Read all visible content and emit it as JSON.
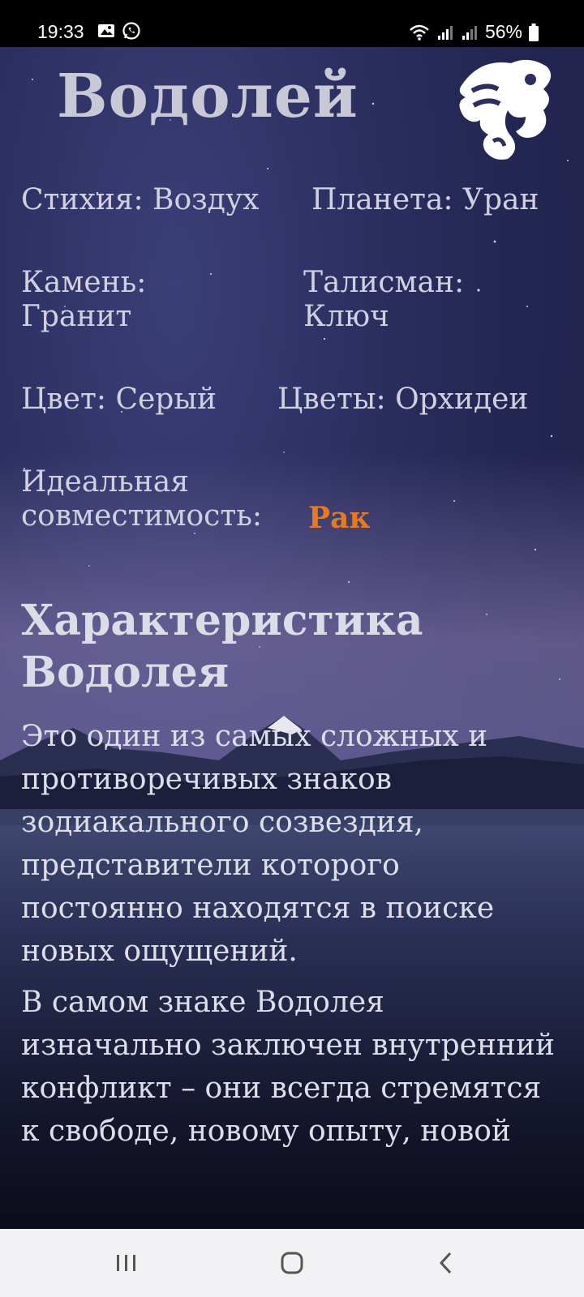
{
  "status_bar": {
    "time": "19:33",
    "battery": "56%",
    "icons": [
      "gallery-icon",
      "whatsapp-icon",
      "wifi-icon",
      "signal-icon",
      "signal-icon",
      "battery-icon"
    ]
  },
  "header": {
    "title": "Водолей",
    "emblem_icon": "aquarius-emblem-icon"
  },
  "info": {
    "element": "Стихия: Воздух",
    "planet": "Планета: Уран",
    "stone_line1": "Камень:",
    "stone_line2": "Гранит",
    "talisman_line1": "Талисман:",
    "talisman_line2": "Ключ",
    "color": "Цвет: Серый",
    "flowers": "Цветы: Орхидеи",
    "compat_line1": "Идеальная",
    "compat_line2": "совместимость:",
    "compat_value": "Рак"
  },
  "section": {
    "title_line1": "Характеристика",
    "title_line2": "Водолея",
    "paragraph1": "Это один из самых сложных и противоречивых знаков зодиакального созвездия, представители которого постоянно находятся в поиске новых ощущений.",
    "paragraph2": "В самом знаке Водолея изначально заключен внутренний конфликт – они всегда стремятся к свободе, новому опыту, новой"
  },
  "colors": {
    "accent": "#e87a1d",
    "text": "#d6d6e6",
    "sky": "#2b2e5f"
  },
  "nav_bar": {
    "icons": [
      "recent-apps-icon",
      "home-icon",
      "back-icon"
    ]
  }
}
